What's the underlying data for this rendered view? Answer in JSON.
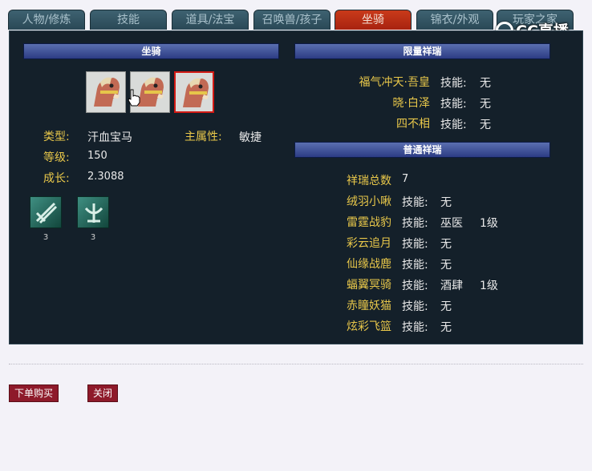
{
  "tabs": [
    "人物/修炼",
    "技能",
    "道具/法宝",
    "召唤兽/孩子",
    "坐骑",
    "锦衣/外观",
    "玩家之家"
  ],
  "logo": "CC直播",
  "left": {
    "title": "坐骑",
    "type_label": "类型:",
    "type_value": "汗血宝马",
    "attr_label": "主属性:",
    "attr_value": "敏捷",
    "level_label": "等级:",
    "level_value": "150",
    "growth_label": "成长:",
    "growth_value": "2.3088",
    "skills": [
      {
        "icon": "mount-skill-icon-1",
        "count": "3"
      },
      {
        "icon": "mount-skill-icon-2",
        "count": "3"
      }
    ]
  },
  "limited": {
    "title": "限量祥瑞",
    "items": [
      {
        "name": "福气冲天·吾皇",
        "skill_label": "技能:",
        "skill": "无"
      },
      {
        "name": "晓·白泽",
        "skill_label": "技能:",
        "skill": "无"
      },
      {
        "name": "四不相",
        "skill_label": "技能:",
        "skill": "无"
      }
    ]
  },
  "common": {
    "title": "普通祥瑞",
    "total_label": "祥瑞总数",
    "total": "7",
    "items": [
      {
        "name": "绒羽小啾",
        "skill_label": "技能:",
        "skill": "无",
        "level": ""
      },
      {
        "name": "雷霆战豹",
        "skill_label": "技能:",
        "skill": "巫医",
        "level": "1级"
      },
      {
        "name": "彩云追月",
        "skill_label": "技能:",
        "skill": "无",
        "level": ""
      },
      {
        "name": "仙缘战鹿",
        "skill_label": "技能:",
        "skill": "无",
        "level": ""
      },
      {
        "name": "蝠翼冥骑",
        "skill_label": "技能:",
        "skill": "酒肆",
        "level": "1级"
      },
      {
        "name": "赤瞳妖猫",
        "skill_label": "技能:",
        "skill": "无",
        "level": ""
      },
      {
        "name": "炫彩飞篮",
        "skill_label": "技能:",
        "skill": "无",
        "level": ""
      }
    ]
  },
  "buttons": {
    "buy": "下单购买",
    "close": "关闭"
  },
  "colors": {
    "tab_active": "#b52c14",
    "panel_bg": "#14202a",
    "label_gold": "#e8c74a",
    "button_red": "#8e1a2a"
  }
}
